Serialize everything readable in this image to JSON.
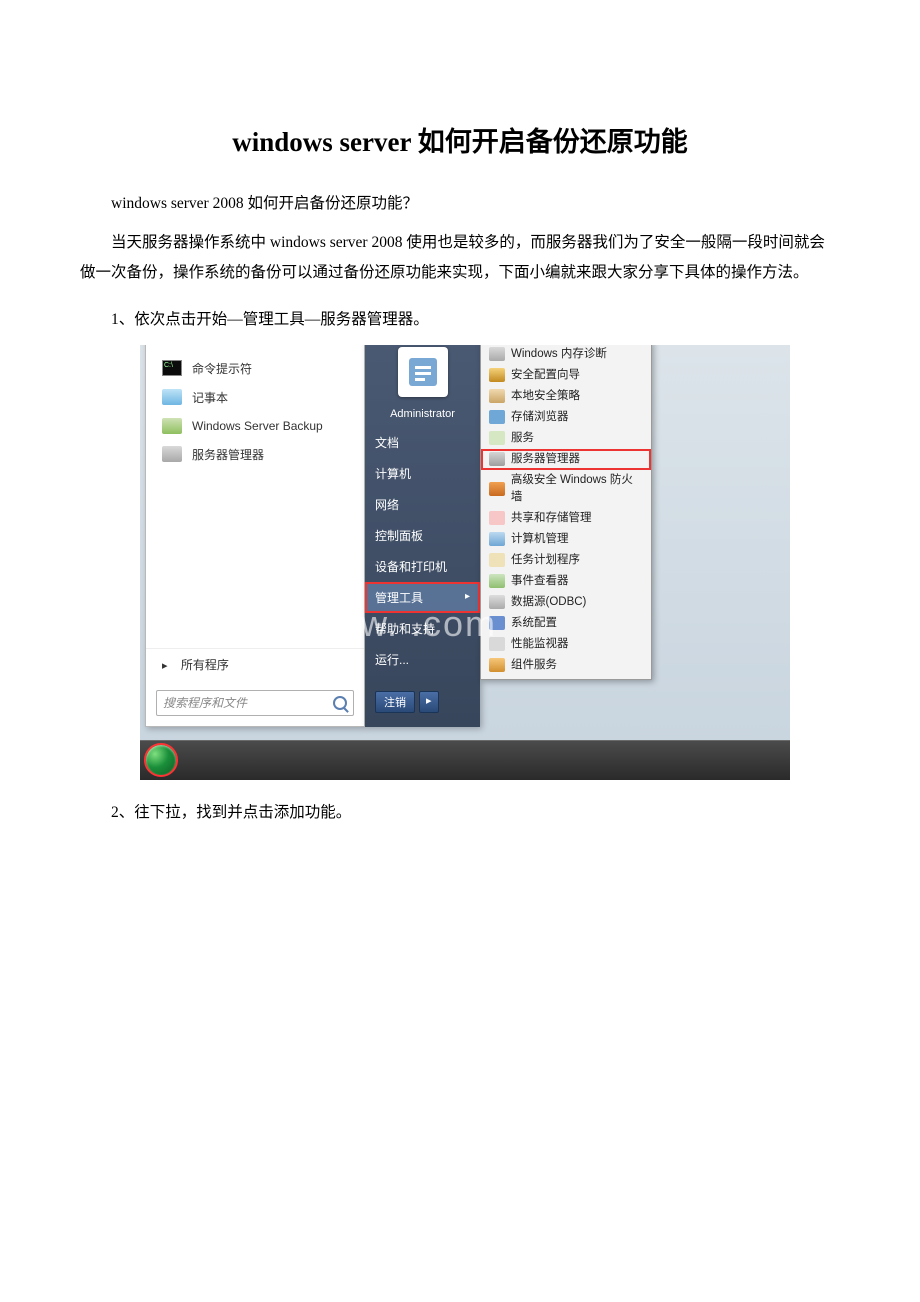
{
  "title": "windows server 如何开启备份还原功能",
  "intro_q": "windows server 2008 如何开启备份还原功能？",
  "intro_body": "当天服务器操作系统中 windows server 2008 使用也是较多的，而服务器我们为了安全一般隔一段时间就会做一次备份，操作系统的备份可以通过备份还原功能来实现，下面小编就来跟大家分享下具体的操作方法。",
  "step1": "1、依次点击开始—管理工具—服务器管理器。",
  "step2": "2、往下拉，找到并点击添加功能。",
  "watermark": "www.             .com",
  "start_menu": {
    "left_items": [
      {
        "label": "命令提示符"
      },
      {
        "label": "记事本"
      },
      {
        "label": "Windows Server Backup"
      },
      {
        "label": "服务器管理器"
      }
    ],
    "all_programs": "所有程序",
    "search_placeholder": "搜索程序和文件",
    "user": "Administrator",
    "right_items": [
      "文档",
      "计算机",
      "网络",
      "控制面板",
      "设备和打印机",
      "管理工具",
      "帮助和支持",
      "运行..."
    ],
    "highlight_right": "管理工具",
    "logoff": "注销",
    "logoff_arrow": "▸"
  },
  "admin_tools": [
    {
      "label": "Windows 内存诊断",
      "cls": "mi-mem"
    },
    {
      "label": "安全配置向导",
      "cls": "mi-shield"
    },
    {
      "label": "本地安全策略",
      "cls": "mi-policy"
    },
    {
      "label": "存储浏览器",
      "cls": "mi-storage"
    },
    {
      "label": "服务",
      "cls": "mi-svc"
    },
    {
      "label": "服务器管理器",
      "cls": "mi-srvmgr",
      "hl": true
    },
    {
      "label": "高级安全 Windows 防火墙",
      "cls": "mi-fw"
    },
    {
      "label": "共享和存储管理",
      "cls": "mi-share"
    },
    {
      "label": "计算机管理",
      "cls": "mi-compmgmt"
    },
    {
      "label": "任务计划程序",
      "cls": "mi-task"
    },
    {
      "label": "事件查看器",
      "cls": "mi-event"
    },
    {
      "label": "数据源(ODBC)",
      "cls": "mi-odbc"
    },
    {
      "label": "系统配置",
      "cls": "mi-sys"
    },
    {
      "label": "性能监视器",
      "cls": "mi-perf"
    },
    {
      "label": "组件服务",
      "cls": "mi-comp"
    }
  ]
}
